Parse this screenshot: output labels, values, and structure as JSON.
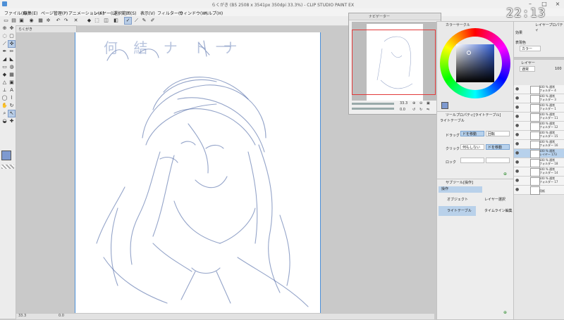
{
  "window": {
    "title": "らくがき (B5 2508 x 3541px 350dpi 33.3%) - CLIP STUDIO PAINT EX"
  },
  "menu": [
    "ファイル(F)",
    "編集(E)",
    "ページ管理(P)",
    "アニメーション(A)",
    "レイヤー(L)",
    "選択範囲(S)",
    "表示(V)",
    "フィルター(I)",
    "ウィンドウ(W)",
    "ヘルプ(H)"
  ],
  "document_tab": "らくがき",
  "clock": "22:13",
  "canvas_sketch": {
    "text_marks": "何 結 ナ ト ナ"
  },
  "navigator": {
    "title": "ナビゲーター",
    "zoom": "33.3",
    "rotation": "0.0"
  },
  "color_wheel": {
    "title": "カラーサークル"
  },
  "tool_property": {
    "title": "ツールプロパティ[ライトテーブル]",
    "tool_name": "ライトテーブル",
    "rows": [
      {
        "label": "ドラッグ",
        "options": [
          "ドを移動",
          "回転"
        ],
        "selected": 0
      },
      {
        "label": "クリック",
        "options": [
          "何もしない",
          "ドを移動"
        ],
        "selected": 1
      },
      {
        "label": "ロック",
        "options": [
          "",
          ""
        ],
        "selected": -1
      }
    ]
  },
  "sub_tool": {
    "title": "サブツール[操作]",
    "group_tab": "操作",
    "items": [
      "オブジェクト",
      "レイヤー選択",
      "ライトテーブル",
      "タイムライン編集"
    ],
    "selected": "ライトテーブル"
  },
  "layer_property": {
    "title": "レイヤープロパティ",
    "effect_label": "効果",
    "expression_label": "表現色",
    "expression_value": "カラー"
  },
  "layer_panel": {
    "title": "レイヤー",
    "blend_mode": "通常",
    "opacity": "100",
    "layers": [
      {
        "name1": "100 % 通常",
        "name2": "フォルダー 4",
        "selected": false
      },
      {
        "name1": "100 % 通常",
        "name2": "フォルダー 3",
        "selected": false
      },
      {
        "name1": "100 % 通常",
        "name2": "フォルダー 1",
        "selected": false
      },
      {
        "name1": "100 % 通常",
        "name2": "フォルダー 11",
        "selected": false
      },
      {
        "name1": "100 % 通常",
        "name2": "フォルダー 12",
        "selected": false
      },
      {
        "name1": "100 % 通常",
        "name2": "フォルダー 15",
        "selected": false
      },
      {
        "name1": "100 % 通常",
        "name2": "フォルダー 16",
        "selected": false
      },
      {
        "name1": "100 % 通常",
        "name2": "レイヤー 173",
        "selected": true
      },
      {
        "name1": "100 % 通常",
        "name2": "フォルダー 18",
        "selected": false
      },
      {
        "name1": "100 % 通常",
        "name2": "フォルダー 14",
        "selected": false
      },
      {
        "name1": "100 % 通常",
        "name2": "フォルダー 17",
        "selected": false
      },
      {
        "name1": "",
        "name2": "用紙",
        "selected": false
      }
    ]
  },
  "status": {
    "zoom": "33.3",
    "rotation": "0.0"
  },
  "colors": {
    "accent": "#4a8fd8",
    "selection": "#b7d1ec",
    "sketch": "#3d5a9c",
    "navigator_frame": "#e23a3a"
  }
}
